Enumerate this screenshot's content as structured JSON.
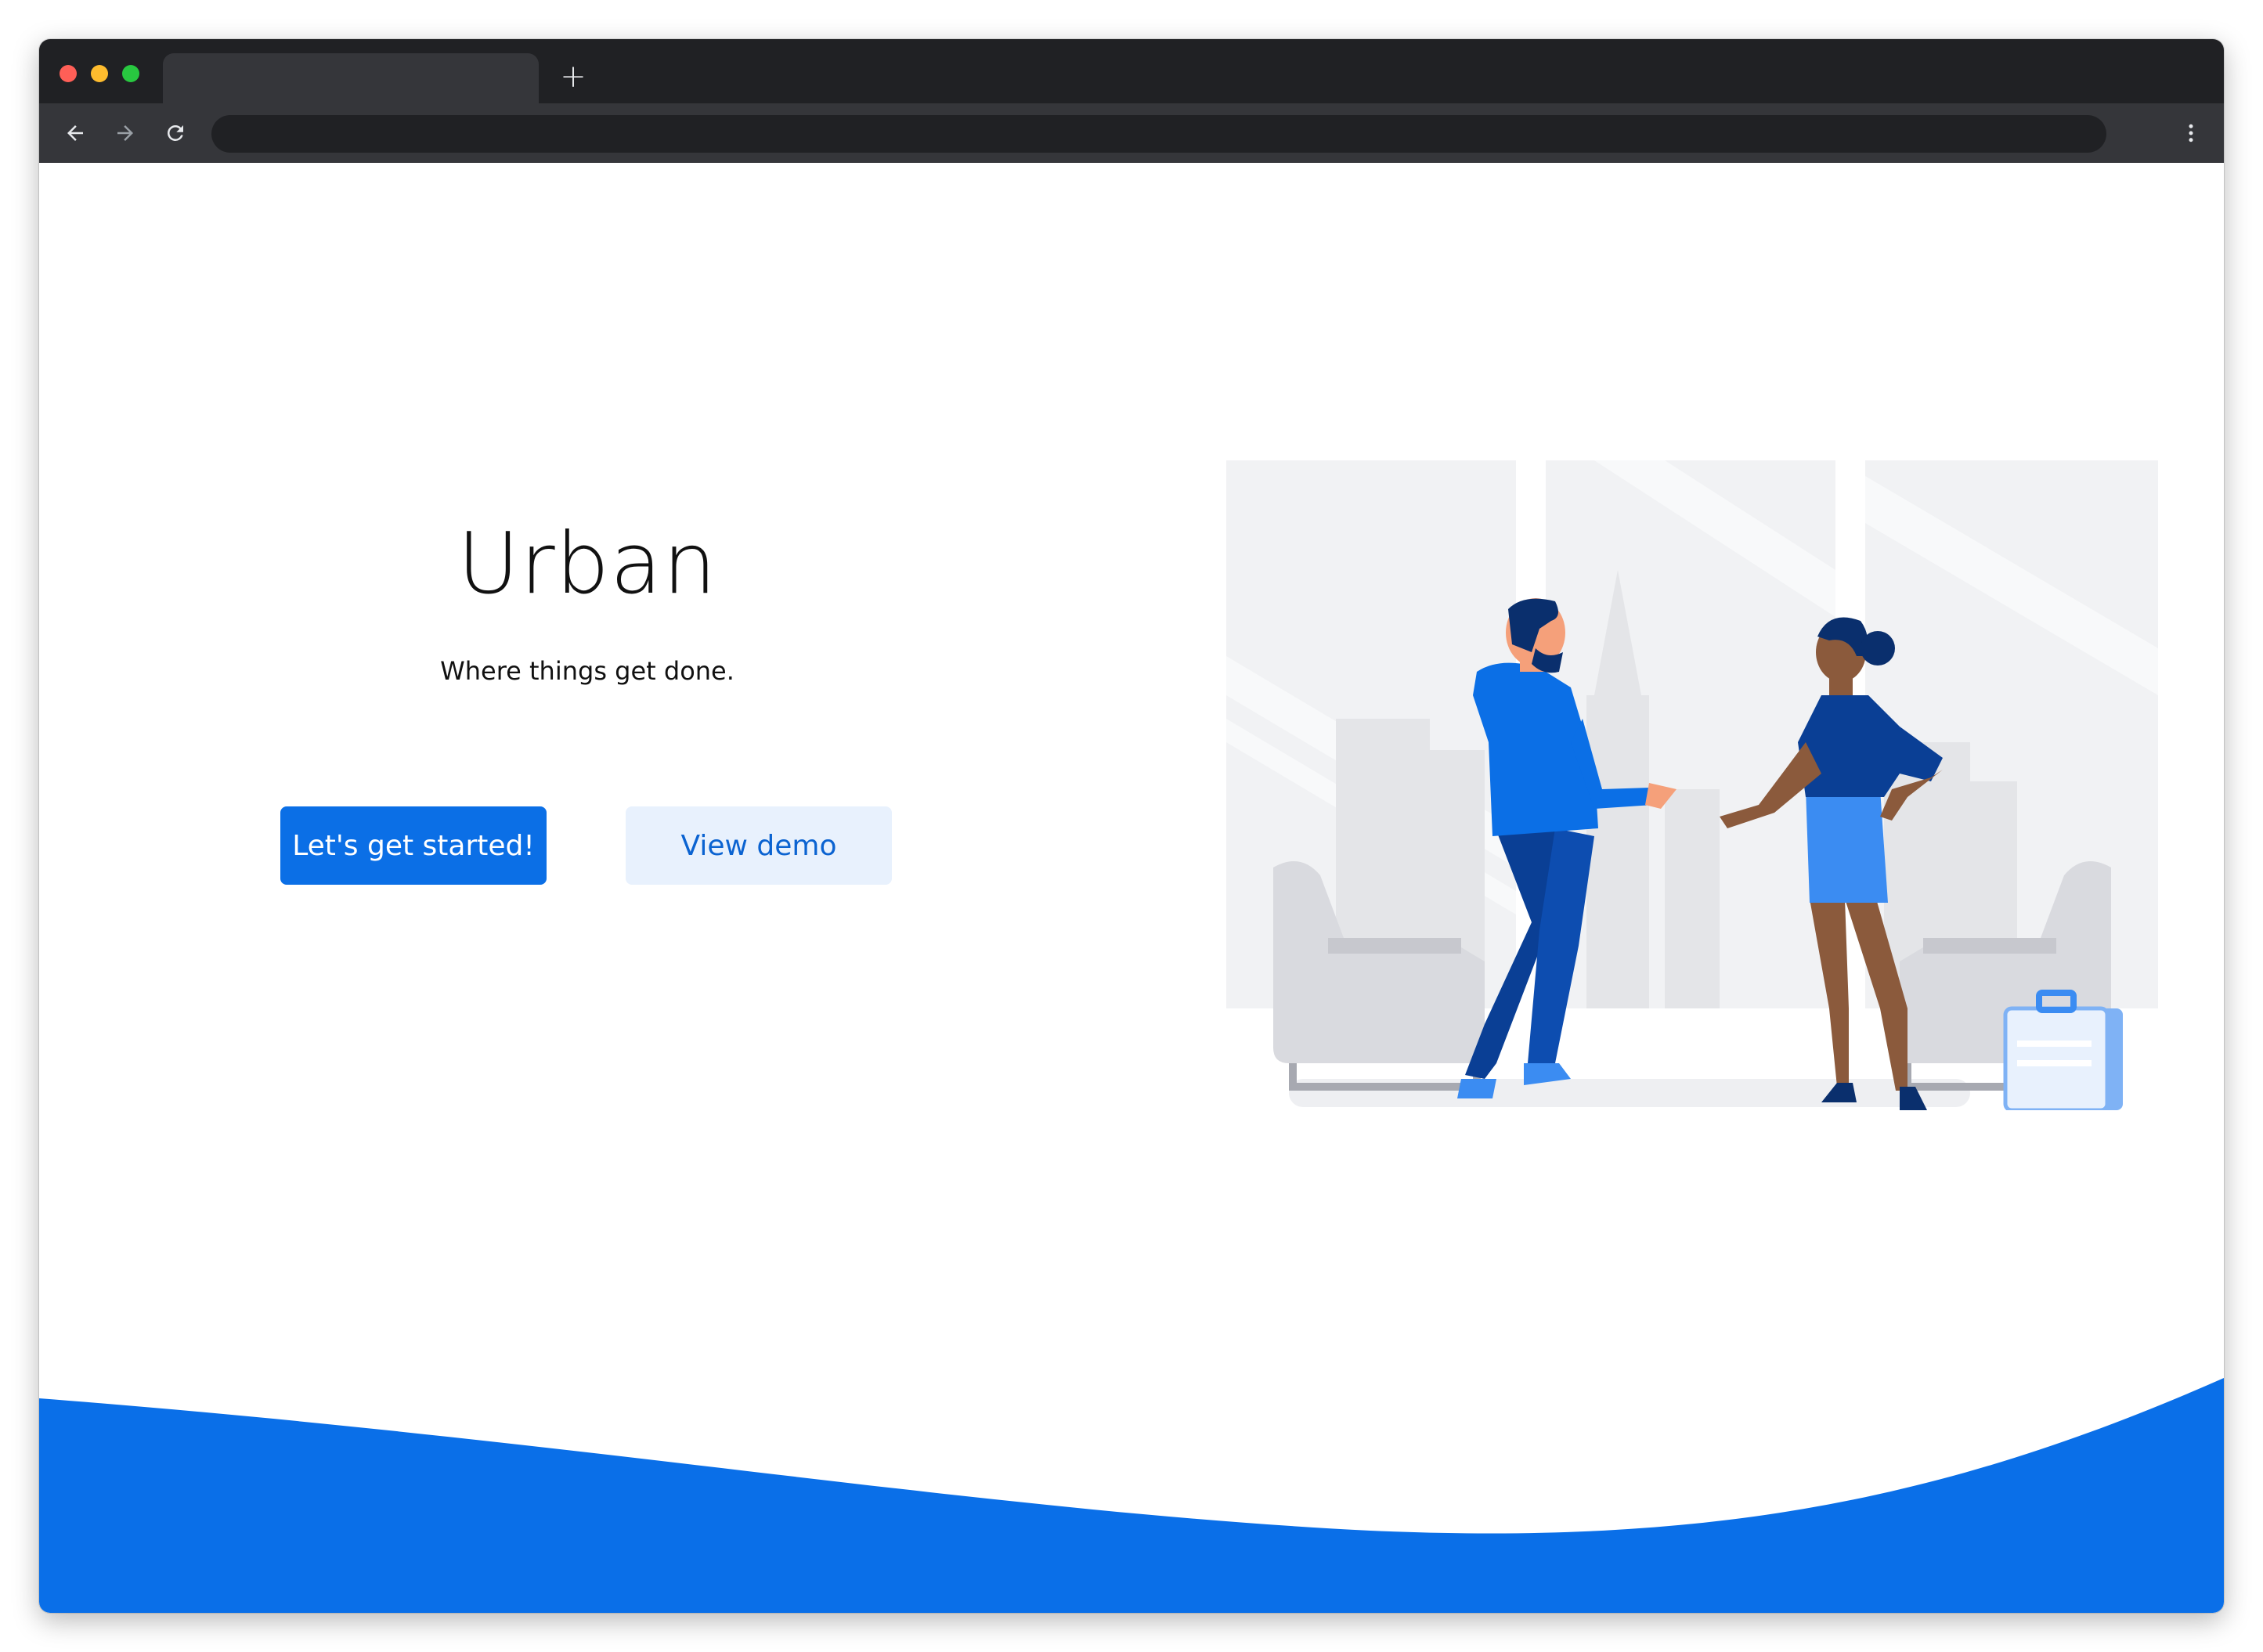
{
  "browser": {
    "new_tab_symbol": "+",
    "icons": [
      "back-arrow-icon",
      "forward-arrow-icon",
      "reload-icon",
      "more-vert-icon",
      "plus-icon"
    ]
  },
  "hero": {
    "title": "Urban",
    "subtitle": "Where things get done.",
    "primary_button": "Let's get started!",
    "secondary_button": "View demo"
  },
  "colors": {
    "accent": "#0b6fe6",
    "secondary_button_bg": "#e8f1fd",
    "secondary_button_text": "#0b63d1",
    "wave": "#0a6fe8",
    "chrome_dark": "#202124",
    "chrome_toolbar": "#35363a"
  }
}
